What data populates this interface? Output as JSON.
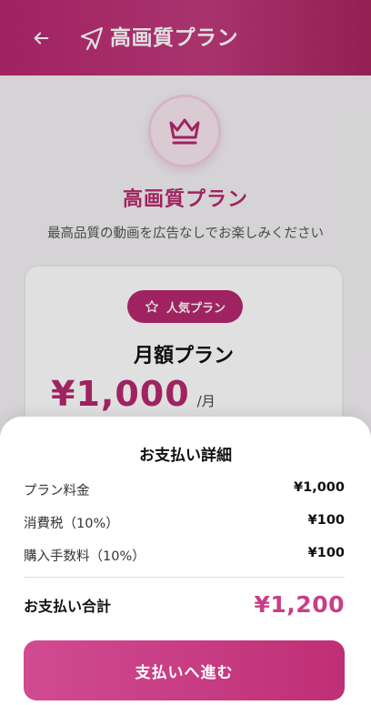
{
  "header": {
    "title": "高画質プラン",
    "back_icon": "arrow-left-icon",
    "logo_icon": "cursor-arrow-icon"
  },
  "main": {
    "crown_icon": "crown-icon",
    "plan_title": "高画質プラン",
    "plan_subtitle": "最高品質の動画を広告なしでお楽しみください",
    "card": {
      "badge_label": "人気プラン",
      "badge_icon": "star-outline-icon",
      "plan_name": "月額プラン",
      "price": "¥1,000",
      "price_unit": "/月"
    }
  },
  "payment_sheet": {
    "title": "お支払い詳細",
    "items": [
      {
        "label": "プラン料金",
        "value": "¥1,000"
      },
      {
        "label": "消費税（10%）",
        "value": "¥100"
      },
      {
        "label": "購入手数料（10%）",
        "value": "¥100"
      }
    ],
    "total_label": "お支払い合計",
    "total_value": "¥1,200",
    "pay_button_label": "支払いへ進む"
  },
  "colors": {
    "brand": "#b7286f",
    "accent": "#c83f86"
  }
}
